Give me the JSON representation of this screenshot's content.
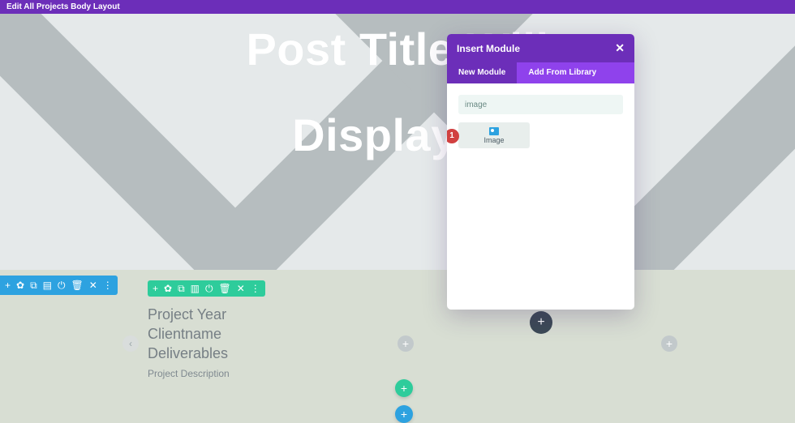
{
  "topbar": {
    "title": "Edit All Projects Body Layout"
  },
  "hero": {
    "title": "Post Title Will",
    "subtitle": "Display H"
  },
  "section_toolbar": {
    "add": "+",
    "gear": "✿",
    "dup": "⧉",
    "save": "▤",
    "power": "⏻",
    "trash": "🗑",
    "close": "✕",
    "more": "⋮"
  },
  "row_toolbar": {
    "add": "+",
    "gear": "✿",
    "dup": "⧉",
    "cols": "▥",
    "power": "⏻",
    "trash": "🗑",
    "close": "✕",
    "more": "⋮"
  },
  "project": {
    "line1": "Project Year",
    "line2": "Clientname",
    "line3": "Deliverables",
    "desc": "Project Description"
  },
  "columns": {
    "placeholder": "+",
    "left_arrow": "‹"
  },
  "floating": {
    "add_dark": "+",
    "add_green": "+",
    "add_blue": "+"
  },
  "modal": {
    "title": "Insert Module",
    "close": "✕",
    "tabs": {
      "new": "New Module",
      "lib": "Add From Library"
    },
    "search_value": "image",
    "items": [
      {
        "label": "Image",
        "badge": "1"
      }
    ]
  }
}
